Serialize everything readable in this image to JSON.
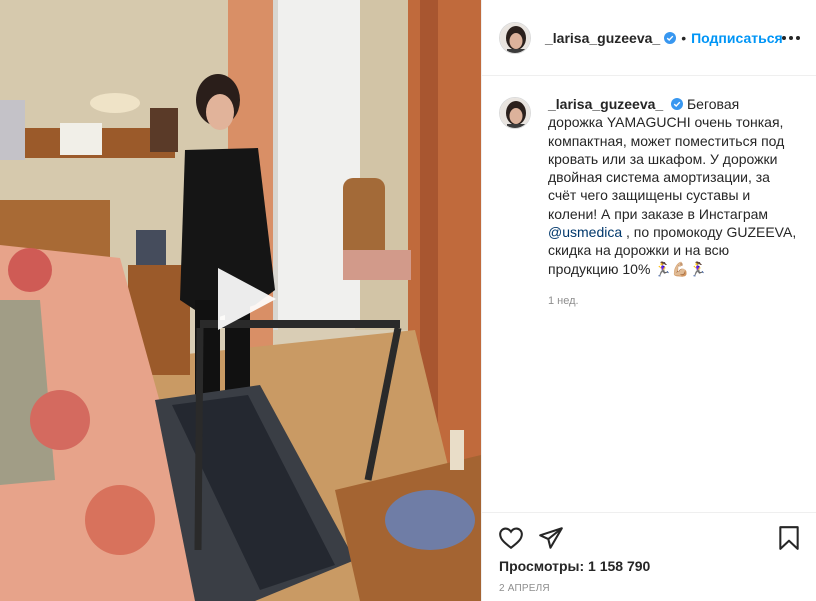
{
  "post": {
    "media": {
      "type": "video",
      "description_icon": "play-icon"
    },
    "header": {
      "username": "_larisa_guzeeva_",
      "separator": "•",
      "follow_label": "Подписаться"
    },
    "caption": {
      "username": "_larisa_guzeeva_",
      "text_before_mention": "Беговая дорожка YAMAGUCHI очень тонкая, компактная, может поместиться под кровать или за шкафом. У дорожки двойная система амортизации, за счёт чего защищены суставы и колени! А при заказе в Инстаграм",
      "mention": "@usmedica",
      "text_after_mention": ", по промокоду GUZEEVA, скидка на дорожки и на всю продукцию 10% 🏃‍♀️💪🏼🏃‍♀️",
      "time_ago": "1 нед."
    },
    "actions": {
      "like_icon": "heart-icon",
      "share_icon": "send-icon",
      "save_icon": "bookmark-icon"
    },
    "views_label": "Просмотры: 1 158 790",
    "date": "2 АПРЕЛЯ"
  },
  "colors": {
    "link_blue": "#0095f6",
    "mention_blue": "#00376b",
    "verified_blue": "#3897f0",
    "secondary_text": "#8e8e8e",
    "divider": "#efefef"
  }
}
